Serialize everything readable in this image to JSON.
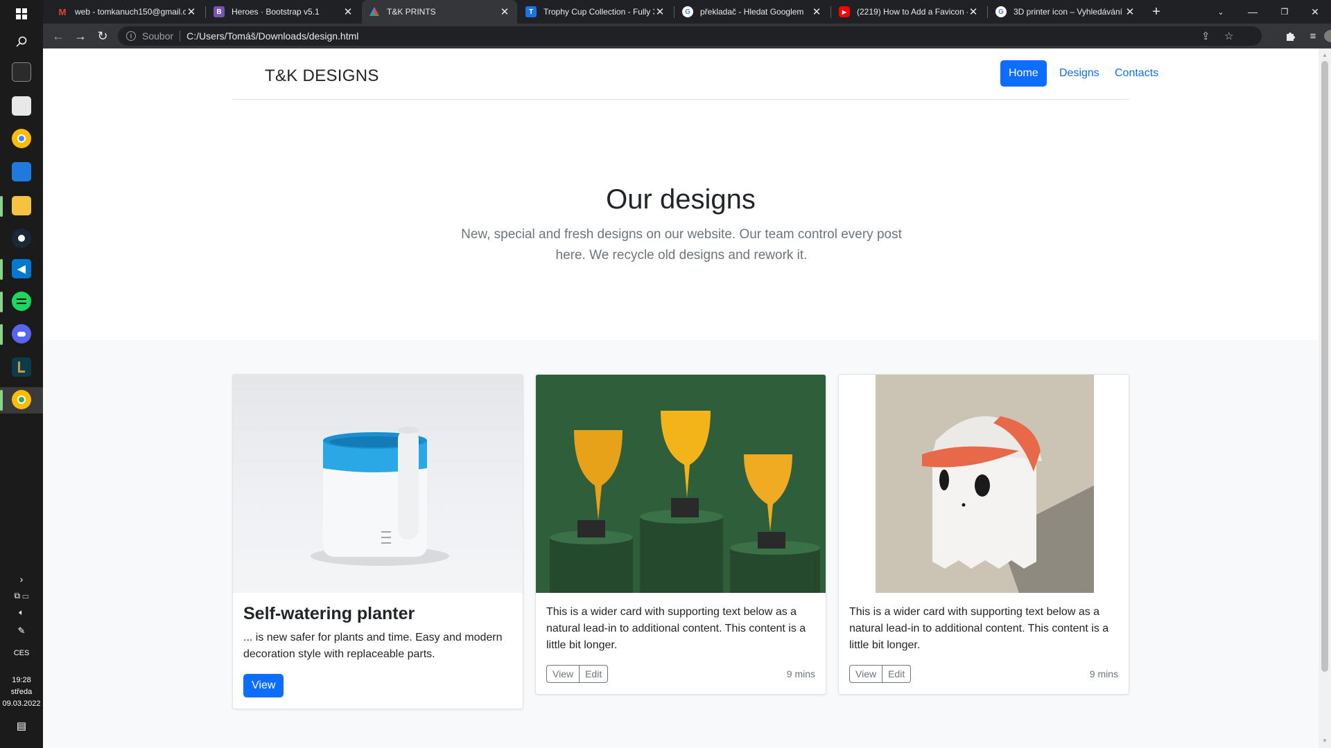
{
  "browser": {
    "tabs": [
      {
        "title": "web - tomkanuch150@gmail.c",
        "favicon": "gmail-icon",
        "color": "#ea4335"
      },
      {
        "title": "Heroes · Bootstrap v5.1",
        "favicon": "bootstrap-icon",
        "color": "#7952b3"
      },
      {
        "title": "T&K PRINTS",
        "favicon": "tk-prints-icon",
        "color": "#2ea44f"
      },
      {
        "title": "Trophy Cup Collection - Fully 3",
        "favicon": "trophy-site-icon",
        "color": "#1a73e8"
      },
      {
        "title": "překladač - Hledat Googlem",
        "favicon": "google-icon",
        "color": "#ffffff"
      },
      {
        "title": "(2219) How to Add a Favicon -",
        "favicon": "youtube-icon",
        "color": "#ff0000"
      },
      {
        "title": "3D printer icon – Vyhledávání",
        "favicon": "google-icon",
        "color": "#ffffff"
      }
    ],
    "active_tab": 2,
    "address": {
      "scheme_label": "Soubor",
      "url": "C:/Users/Tomáš/Downloads/design.html"
    }
  },
  "taskbar": {
    "language": "CES",
    "time": "19:28",
    "day": "středa",
    "date": "09.03.2022"
  },
  "site": {
    "brand": "T&K DESIGNS",
    "nav": [
      {
        "label": "Home",
        "active": true
      },
      {
        "label": "Designs",
        "active": false
      },
      {
        "label": "Contacts",
        "active": false
      }
    ],
    "hero": {
      "title": "Our designs",
      "lead": "New, special and fresh designs on our website. Our team control every post here. We recycle old designs and rework it."
    },
    "cards": [
      {
        "title": "Self-watering planter",
        "text": "... is new safer for plants and time. Easy and modern decoration style with replaceable parts.",
        "button": "View",
        "image": "planter-photo"
      },
      {
        "text": "This is a wider card with supporting text below as a natural lead-in to additional content. This content is a little bit longer.",
        "view": "View",
        "edit": "Edit",
        "time": "9 mins",
        "image": "trophies-photo"
      },
      {
        "text": "This is a wider card with supporting text below as a natural lead-in to additional content. This content is a little bit longer.",
        "view": "View",
        "edit": "Edit",
        "time": "9 mins",
        "image": "ghost-figure-photo"
      }
    ]
  },
  "colors": {
    "primary": "#0d6efd",
    "muted": "#6c757d",
    "album_bg": "#f8f9fa"
  }
}
